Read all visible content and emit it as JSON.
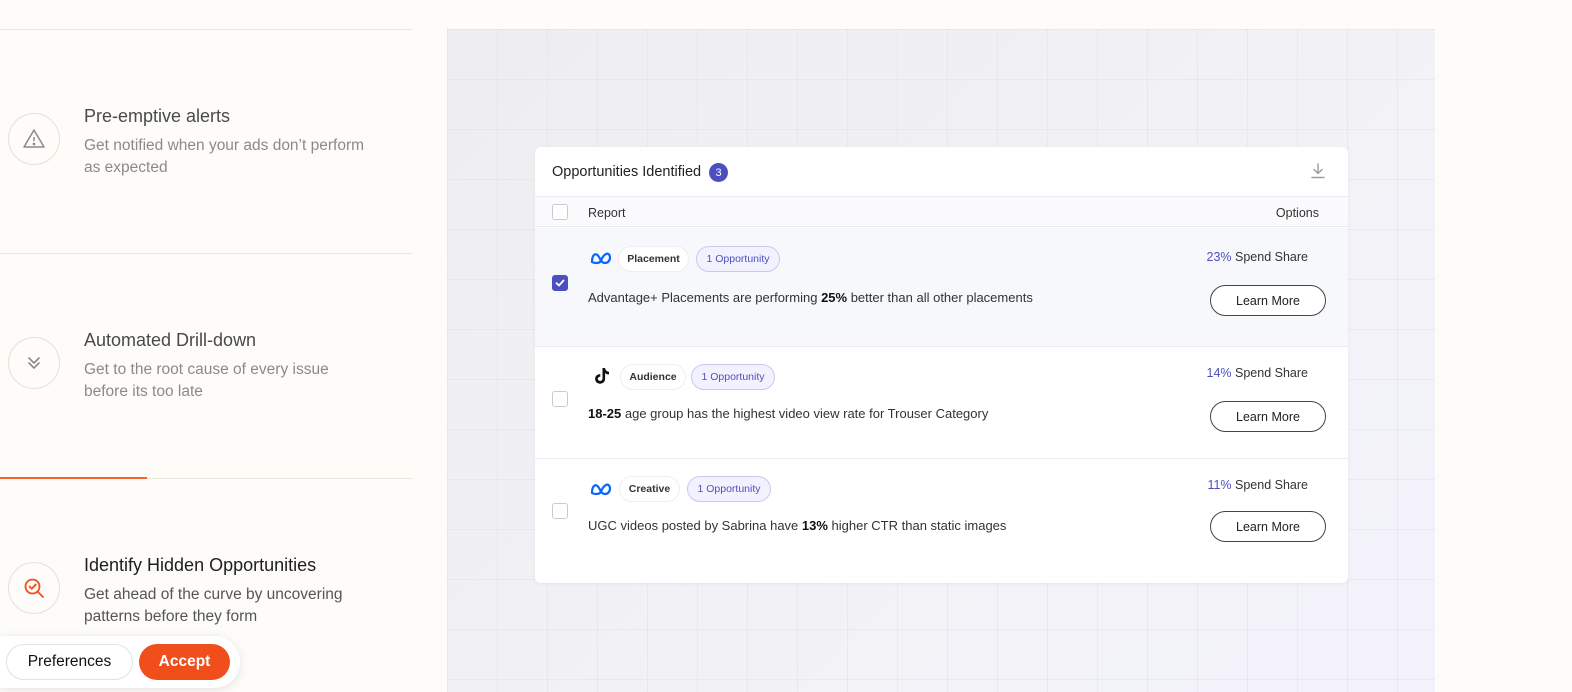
{
  "features": [
    {
      "title": "Pre-emptive alerts",
      "description": "Get notified when your ads don’t perform as expected",
      "icon": "warning-triangle-icon"
    },
    {
      "title": "Automated Drill-down",
      "description": "Get to the root cause of every issue before its too late",
      "icon": "double-chevron-down-icon"
    },
    {
      "title": "Identify Hidden Opportunities",
      "description": "Get ahead of the curve by uncovering patterns before they form",
      "icon": "search-check-icon"
    }
  ],
  "feature_progress": 0.36,
  "cookie_bar": {
    "preferences_label": "Preferences",
    "accept_label": "Accept"
  },
  "card": {
    "title": "Opportunities Identified",
    "count": "3",
    "columns": {
      "report": "Report",
      "options": "Options"
    },
    "rows": [
      {
        "platform": "meta-icon",
        "category": "Placement",
        "opportunity": "1 Opportunity",
        "checked": true,
        "text_before": "Advantage+ Placements are performing ",
        "text_bold": "25%",
        "text_after": " better than all other placements",
        "spend_pct": "23%",
        "spend_label": " Spend Share",
        "button": "Learn More"
      },
      {
        "platform": "tiktok-icon",
        "category": "Audience",
        "opportunity": "1 Opportunity",
        "checked": false,
        "text_before": "",
        "text_bold": "18-25",
        "text_after": " age group has the highest video view rate for Trouser Category",
        "spend_pct": "14%",
        "spend_label": " Spend Share",
        "button": "Learn More"
      },
      {
        "platform": "meta-icon",
        "category": "Creative",
        "opportunity": "1 Opportunity",
        "checked": false,
        "text_before": "UGC videos posted by Sabrina have ",
        "text_bold": "13%",
        "text_after": " higher CTR than static images",
        "spend_pct": "11%",
        "spend_label": " Spend Share",
        "button": "Learn More"
      }
    ]
  },
  "colors": {
    "accent": "#f04e1a",
    "brand_purple": "#4d4fc0",
    "meta_blue": "#0866ff"
  }
}
